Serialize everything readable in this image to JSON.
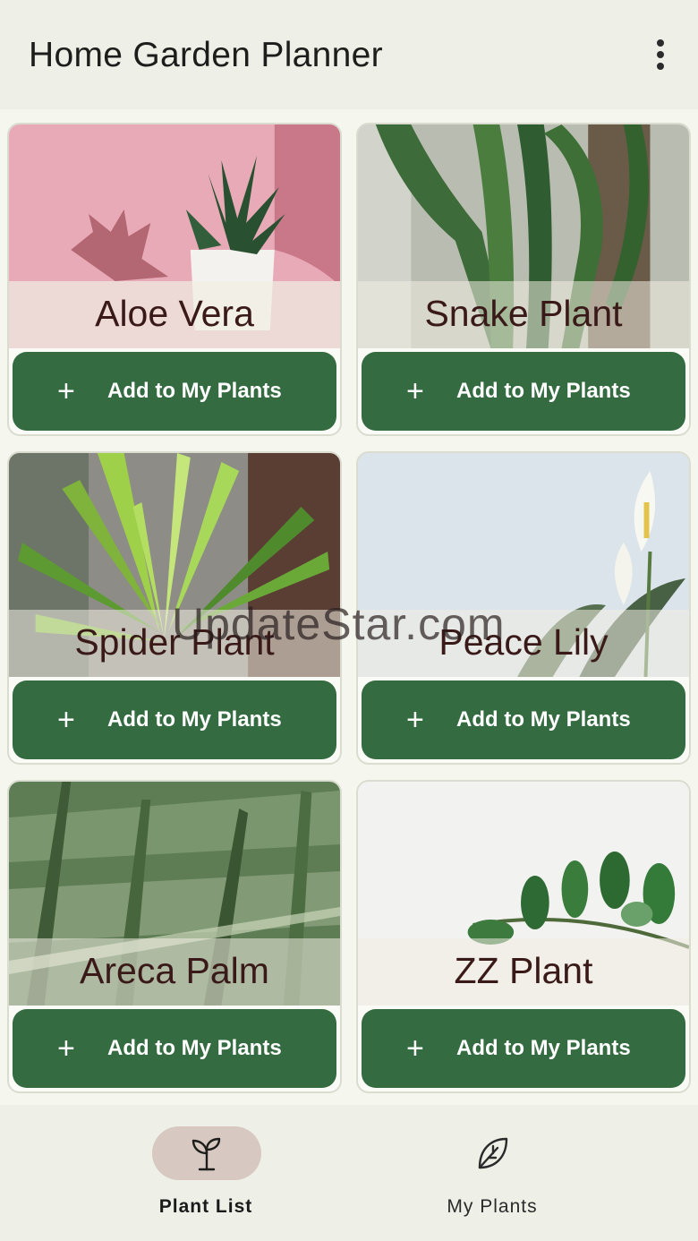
{
  "app": {
    "title": "Home Garden Planner",
    "menu_icon": "more-vert-icon"
  },
  "plants": [
    {
      "name": "Aloe Vera",
      "button_label": "Add to My Plants"
    },
    {
      "name": "Snake Plant",
      "button_label": "Add to My Plants"
    },
    {
      "name": "Spider Plant",
      "button_label": "Add to My Plants"
    },
    {
      "name": "Peace Lily",
      "button_label": "Add to My Plants"
    },
    {
      "name": "Areca Palm",
      "button_label": "Add to My Plants"
    },
    {
      "name": "ZZ Plant",
      "button_label": "Add to My Plants"
    }
  ],
  "add_icon": "plus-icon",
  "watermark": "UpdateStar.com",
  "nav": {
    "items": [
      {
        "label": "Plant List",
        "icon": "sprout-icon",
        "active": true
      },
      {
        "label": "My Plants",
        "icon": "leaf-icon",
        "active": false
      }
    ]
  },
  "colors": {
    "primary": "#346b40",
    "background": "#eef0e8",
    "title_text": "#3a1a18",
    "nav_active_pill": "#d7c8c1"
  }
}
